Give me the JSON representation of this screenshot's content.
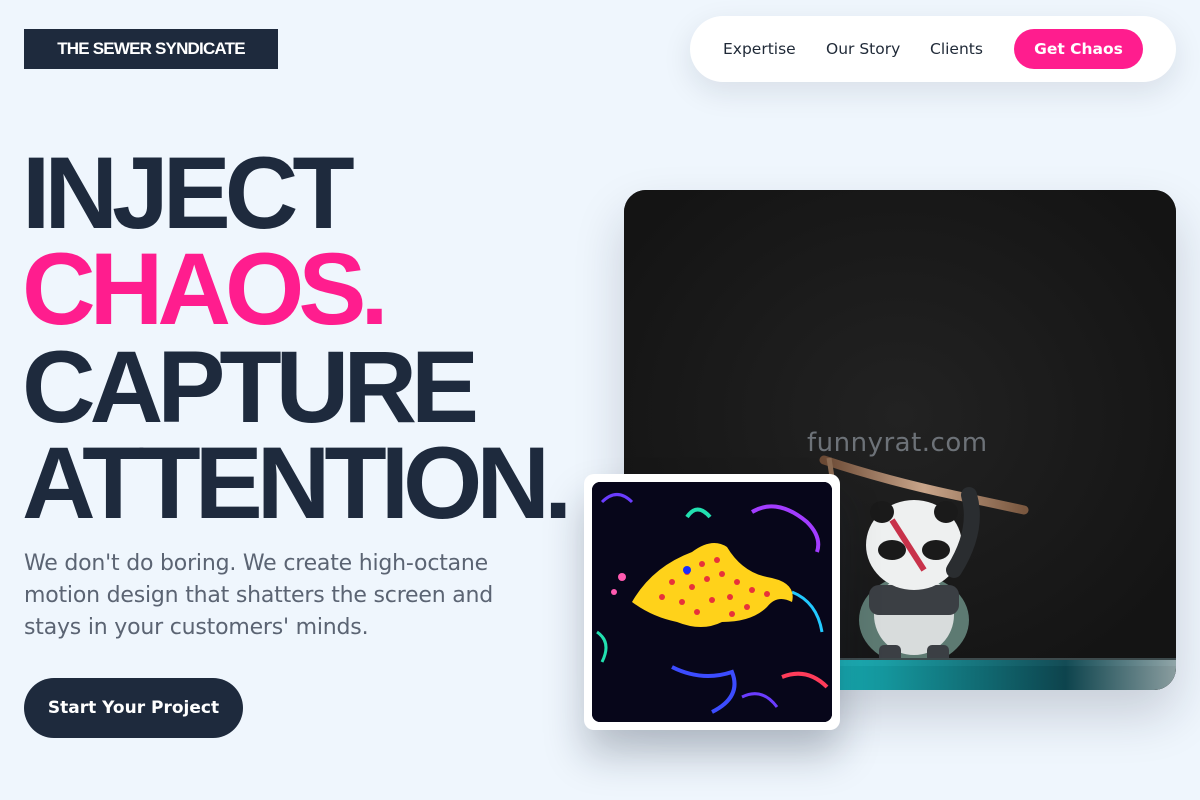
{
  "brand": {
    "name": "THE SEWER SYNDICATE"
  },
  "nav": {
    "links": [
      "Expertise",
      "Our Story",
      "Clients"
    ],
    "cta": "Get Chaos"
  },
  "hero": {
    "line1": "INJECT",
    "line2": "CHAOS.",
    "line3": "CAPTURE",
    "line4": "ATTENTION.",
    "subtitle": "We don't do boring. We create high-octane motion design that shatters the screen and stays in your customers' minds.",
    "cta": "Start Your Project"
  },
  "media": {
    "watermark": "funnyrat.com",
    "main_image": "panda-figurine-with-pipe",
    "thumbnail_image": "neon-yellow-fish-creature"
  },
  "colors": {
    "background": "#eff6fd",
    "navy": "#1e2a3d",
    "accent_pink": "#ff1d8e",
    "text_muted": "#5b6473"
  }
}
